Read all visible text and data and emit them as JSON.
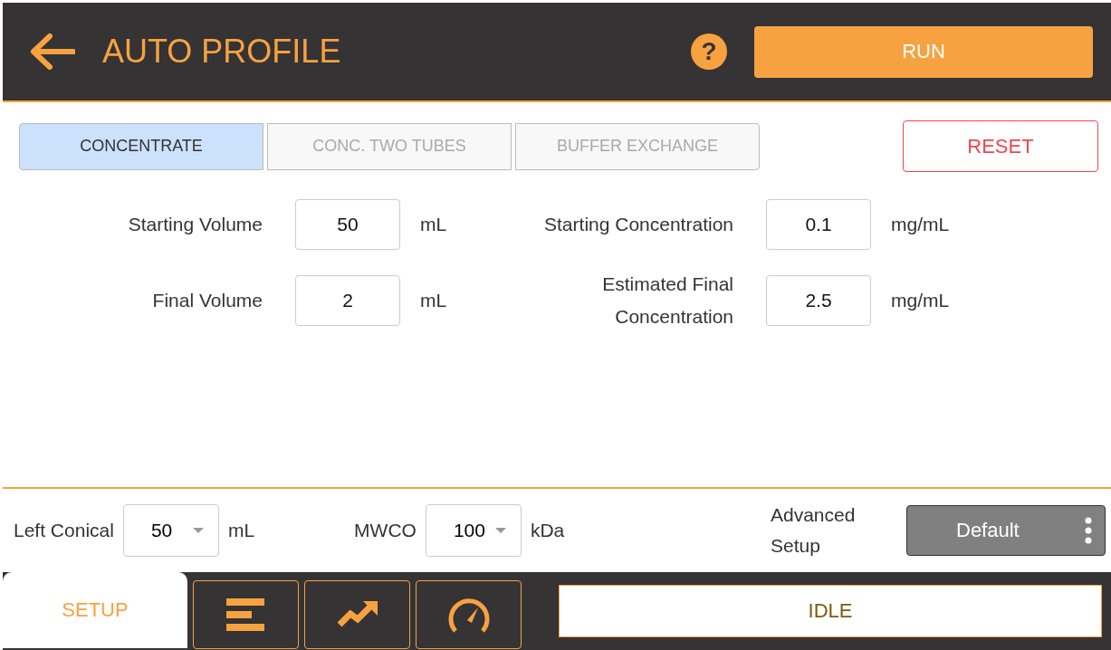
{
  "header": {
    "title": "AUTO PROFILE",
    "help": "?",
    "run_button": "RUN"
  },
  "mode_tabs": [
    {
      "label": "CONCENTRATE",
      "selected": true
    },
    {
      "label": "CONC. TWO TUBES",
      "selected": false
    },
    {
      "label": "BUFFER EXCHANGE",
      "selected": false
    }
  ],
  "reset_button": "RESET",
  "form": {
    "left_column": [
      {
        "label": "Starting Volume",
        "value": "50",
        "unit": "mL"
      },
      {
        "label": "Final Volume",
        "value": "2",
        "unit": "mL"
      }
    ],
    "right_column": [
      {
        "label": "Starting Concentration",
        "value": "0.1",
        "unit": "mg/mL"
      },
      {
        "label": "Estimated Final Concentration",
        "value": "2.5",
        "unit": "mg/mL"
      }
    ]
  },
  "settings": [
    {
      "label": "Left Conical",
      "value": "50",
      "unit": "mL"
    },
    {
      "label": "MWCO",
      "value": "100",
      "unit": "kDa"
    }
  ],
  "advanced": {
    "label": "Advanced Setup",
    "button": "Default"
  },
  "nav_tabs": [
    {
      "kind": "text",
      "label": "SETUP",
      "selected": true
    },
    {
      "kind": "bars",
      "selected": false
    },
    {
      "kind": "trend",
      "selected": false
    },
    {
      "kind": "gauge",
      "selected": false
    }
  ],
  "status": "IDLE"
}
